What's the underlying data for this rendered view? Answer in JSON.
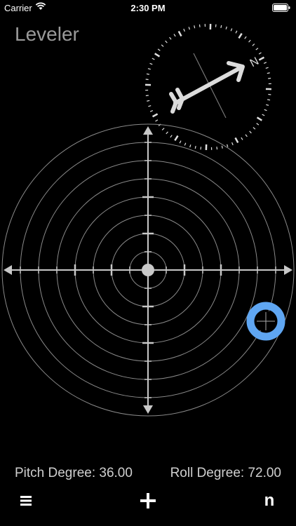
{
  "status_bar": {
    "carrier": "Carrier",
    "time": "2:30 PM"
  },
  "app": {
    "title": "Leveler"
  },
  "compass": {
    "north_label": "N"
  },
  "readouts": {
    "pitch": "Pitch Degree: 36.00",
    "roll": "Roll Degree: 72.00"
  },
  "toolbar": {
    "n_label": "n"
  },
  "icons": [
    "wifi-icon",
    "battery-icon",
    "menu-icon",
    "plus-icon",
    "compass-arrow-icon"
  ],
  "colors": {
    "background": "#000000",
    "bubble": "#5fa6f2",
    "grid": "#8a8a8a",
    "axis": "#c8c8c8"
  }
}
